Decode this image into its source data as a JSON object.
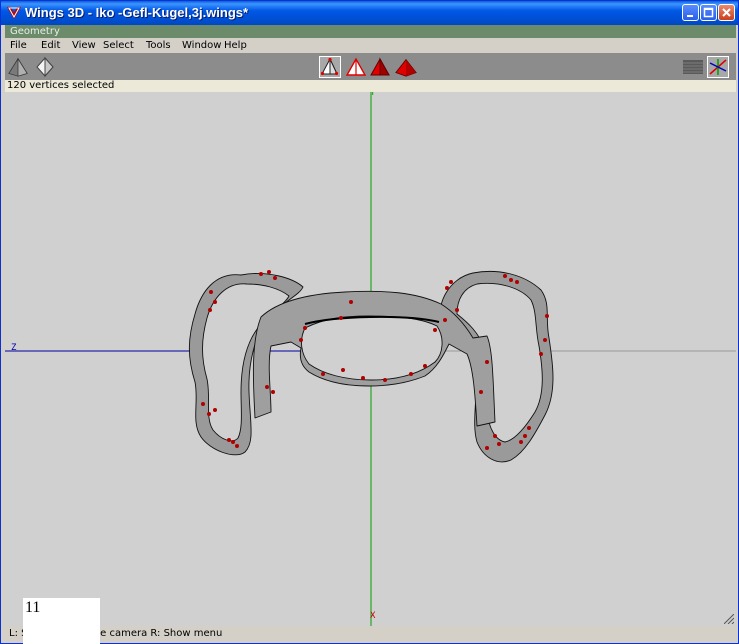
{
  "window": {
    "title": "Wings 3D - Iko -Gefl-Kugel,3j.wings*"
  },
  "geometry_label": "Geometry",
  "menu": [
    "File",
    "Edit",
    "View",
    "Select",
    "Tools",
    "Window",
    "Help"
  ],
  "toolbar": {
    "left_tools": [
      "pyramid-icon",
      "diamond-icon"
    ],
    "mode_tools": [
      "vertex-mode",
      "edge-mode",
      "face-mode",
      "body-mode"
    ],
    "right_tools": [
      "grid-icon",
      "axes-icon"
    ],
    "accent": "#e00000"
  },
  "status": {
    "selection": "120 vertices selected"
  },
  "viewport": {
    "axis_y_label": "Y",
    "axis_z_label": "Z",
    "axis_x_label": "X"
  },
  "infobar": {
    "text": "L:  Select   M: Tumble camera   R: Show menu"
  },
  "overlay": {
    "value": "11"
  }
}
